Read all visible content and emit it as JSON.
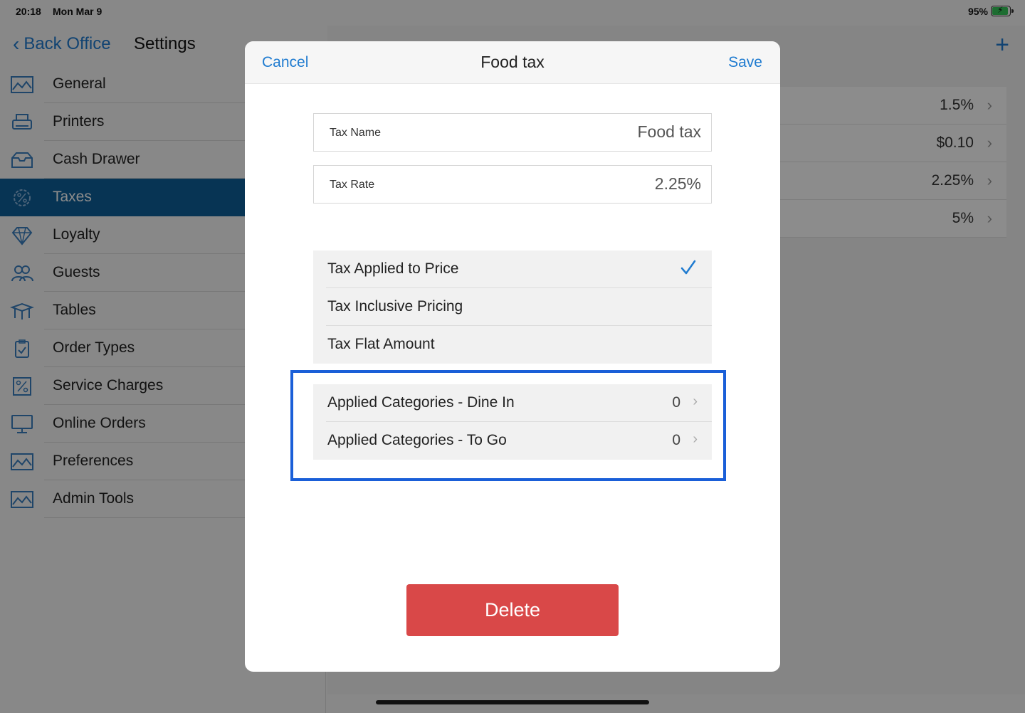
{
  "status_bar": {
    "time": "20:18",
    "date": "Mon Mar 9",
    "battery": "95%"
  },
  "header": {
    "back_label": "Back Office",
    "title": "Settings"
  },
  "sidebar": {
    "items": [
      {
        "label": "General",
        "icon": "general-icon"
      },
      {
        "label": "Printers",
        "icon": "printer-icon"
      },
      {
        "label": "Cash Drawer",
        "icon": "cash-drawer-icon"
      },
      {
        "label": "Taxes",
        "icon": "percent-gear-icon",
        "active": true
      },
      {
        "label": "Loyalty",
        "icon": "diamond-icon"
      },
      {
        "label": "Guests",
        "icon": "guests-icon"
      },
      {
        "label": "Tables",
        "icon": "table-icon"
      },
      {
        "label": "Order Types",
        "icon": "clipboard-icon"
      },
      {
        "label": "Service Charges",
        "icon": "percent-icon"
      },
      {
        "label": "Online Orders",
        "icon": "monitor-icon"
      },
      {
        "label": "Preferences",
        "icon": "preferences-icon"
      },
      {
        "label": "Admin Tools",
        "icon": "admin-tools-icon"
      }
    ]
  },
  "tax_list": {
    "values": [
      "1.5%",
      "$0.10",
      "2.25%",
      "5%"
    ]
  },
  "modal": {
    "cancel": "Cancel",
    "title": "Food tax",
    "save": "Save",
    "tax_name": {
      "label": "Tax Name",
      "value": "Food tax"
    },
    "tax_rate": {
      "label": "Tax Rate",
      "value": "2.25%"
    },
    "options": [
      {
        "label": "Tax Applied to Price",
        "checked": true
      },
      {
        "label": "Tax Inclusive Pricing",
        "checked": false
      },
      {
        "label": "Tax Flat Amount",
        "checked": false
      }
    ],
    "categories": [
      {
        "label": "Applied Categories - Dine In",
        "count": "0"
      },
      {
        "label": "Applied Categories - To Go",
        "count": "0"
      }
    ],
    "delete": "Delete"
  },
  "colors": {
    "accent": "#1f7bd0",
    "active_nav": "#0d5f99",
    "delete": "#d94848",
    "highlight": "#1a5fd8"
  }
}
